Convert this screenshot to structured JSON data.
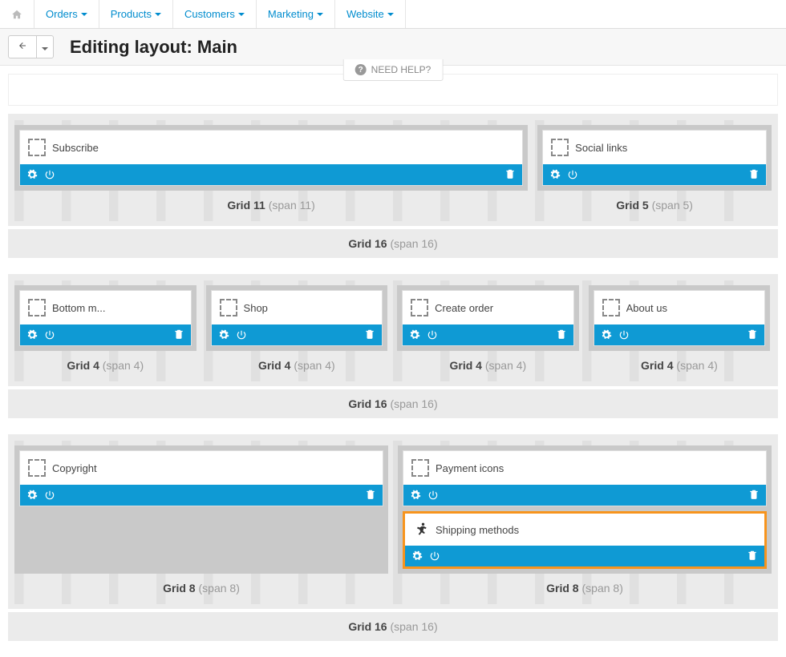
{
  "nav": {
    "orders": "Orders",
    "products": "Products",
    "customers": "Customers",
    "marketing": "Marketing",
    "website": "Website"
  },
  "page_title": "Editing layout: Main",
  "help_label": "NEED HELP?",
  "sections": {
    "row1": {
      "cells": [
        {
          "title": "Subscribe",
          "grid_label": "Grid 11",
          "span_label": "(span 11)"
        },
        {
          "title": "Social links",
          "grid_label": "Grid 5",
          "span_label": "(span 5)"
        }
      ],
      "outer_grid": "Grid 16",
      "outer_span": "(span 16)"
    },
    "row2": {
      "cells": [
        {
          "title": "Bottom m...",
          "grid_label": "Grid 4",
          "span_label": "(span 4)"
        },
        {
          "title": "Shop",
          "grid_label": "Grid 4",
          "span_label": "(span 4)"
        },
        {
          "title": "Create order",
          "grid_label": "Grid 4",
          "span_label": "(span 4)"
        },
        {
          "title": "About us",
          "grid_label": "Grid 4",
          "span_label": "(span 4)"
        }
      ],
      "outer_grid": "Grid 16",
      "outer_span": "(span 16)"
    },
    "row3": {
      "cells": [
        {
          "title": "Copyright",
          "grid_label": "Grid 8",
          "span_label": "(span 8)"
        },
        {
          "title": "Payment icons",
          "title2": "Shipping methods",
          "grid_label": "Grid 8",
          "span_label": "(span 8)"
        }
      ],
      "outer_grid": "Grid 16",
      "outer_span": "(span 16)"
    }
  }
}
